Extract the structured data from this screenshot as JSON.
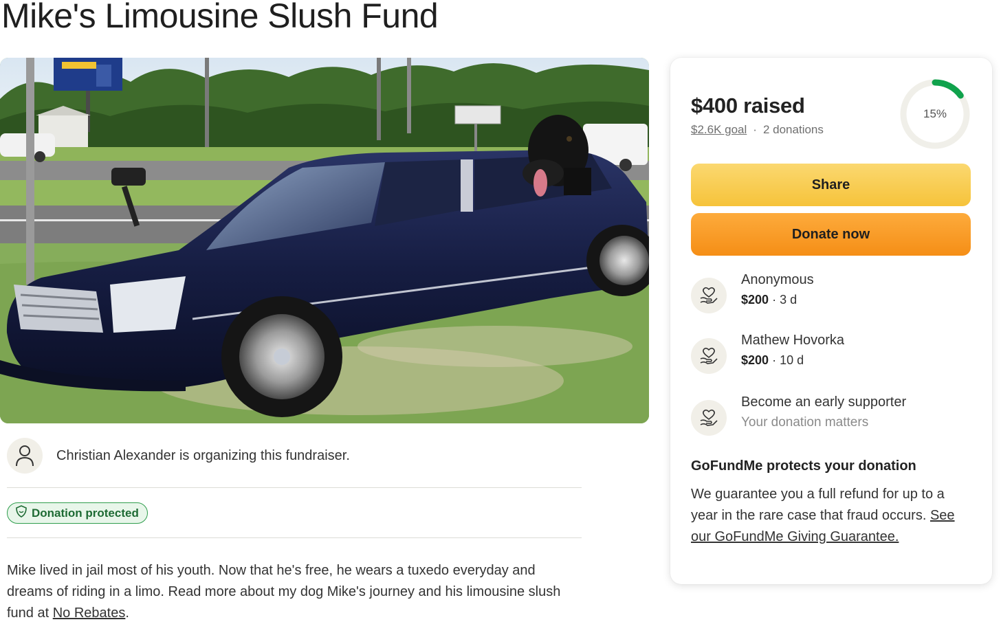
{
  "page_title": "Mike's Limousine Slush Fund",
  "hero": {
    "image_alt": "Dark blue limousine with a large dog leaning out of the rear window"
  },
  "organizer": {
    "text": "Christian Alexander is organizing this fundraiser."
  },
  "badge": {
    "label": "Donation protected"
  },
  "story": {
    "text": "Mike lived in jail most of his youth. Now that he's free, he wears a tuxedo everyday and dreams of riding in a limo. Read more about my dog Mike's journey and his limousine slush fund at ",
    "link": "No Rebates",
    "end": "."
  },
  "sidebar": {
    "raised": "$400 raised",
    "goal": "$2.6K goal",
    "separator": "·",
    "donations": "2 donations",
    "progress_label": "15%",
    "progress_fraction": 0.15,
    "accent_color": "#10a24c",
    "share_label": "Share",
    "donate_label": "Donate now",
    "donors": [
      {
        "name": "Anonymous",
        "amount": "$200",
        "dot": "·",
        "time": "3 d"
      },
      {
        "name": "Mathew Hovorka",
        "amount": "$200",
        "dot": "·",
        "time": "10 d"
      },
      {
        "name": "Become an early supporter",
        "note": "Your donation matters"
      }
    ],
    "protects_title": "GoFundMe protects your donation",
    "protects_text": "We guarantee you a full refund for up to a year in the rare case that fraud occurs. ",
    "protects_link": "See our GoFundMe Giving Guarantee."
  }
}
